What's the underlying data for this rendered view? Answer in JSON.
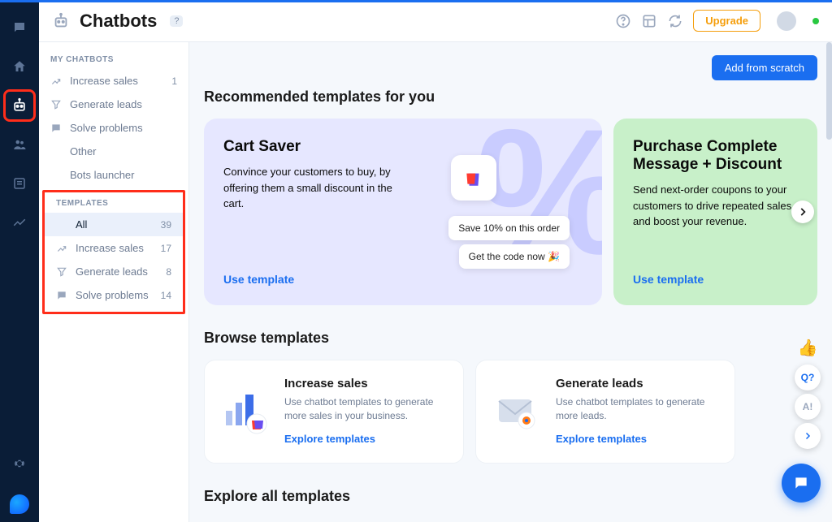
{
  "header": {
    "title": "Chatbots",
    "help_badge": "?",
    "upgrade_label": "Upgrade"
  },
  "sidebar": {
    "section_my": "MY CHATBOTS",
    "section_templates": "TEMPLATES",
    "my": [
      {
        "label": "Increase sales",
        "count": "1"
      },
      {
        "label": "Generate leads"
      },
      {
        "label": "Solve problems"
      },
      {
        "label": "Other"
      },
      {
        "label": "Bots launcher"
      }
    ],
    "templates": [
      {
        "label": "All",
        "count": "39"
      },
      {
        "label": "Increase sales",
        "count": "17"
      },
      {
        "label": "Generate leads",
        "count": "8"
      },
      {
        "label": "Solve problems",
        "count": "14"
      }
    ]
  },
  "content": {
    "add_button": "Add from scratch",
    "rec_heading": "Recommended templates for you",
    "use_template_label": "Use template",
    "rec_cards": [
      {
        "title": "Cart Saver",
        "desc": "Convince your customers to buy, by offering them a small discount in the cart.",
        "chip1": "Save 10% on this order",
        "chip2": "Get the code now"
      },
      {
        "title": "Purchase Complete Message + Discount",
        "desc": "Send next-order coupons to your customers to drive repeated sales and boost your revenue."
      }
    ],
    "browse_heading": "Browse templates",
    "explore_label": "Explore templates",
    "browse_cards": [
      {
        "title": "Increase sales",
        "desc": "Use chatbot templates to generate more sales in your business."
      },
      {
        "title": "Generate leads",
        "desc": "Use chatbot templates to generate more leads."
      }
    ],
    "explore_all_heading": "Explore all templates"
  },
  "float": {
    "q_label": "Q?",
    "ai_label": "A!"
  },
  "colors": {
    "accent": "#1a6ef0",
    "upgrade": "#f59e0b",
    "highlight_box": "#ff2d1a",
    "rail_bg": "#0a1d37"
  }
}
